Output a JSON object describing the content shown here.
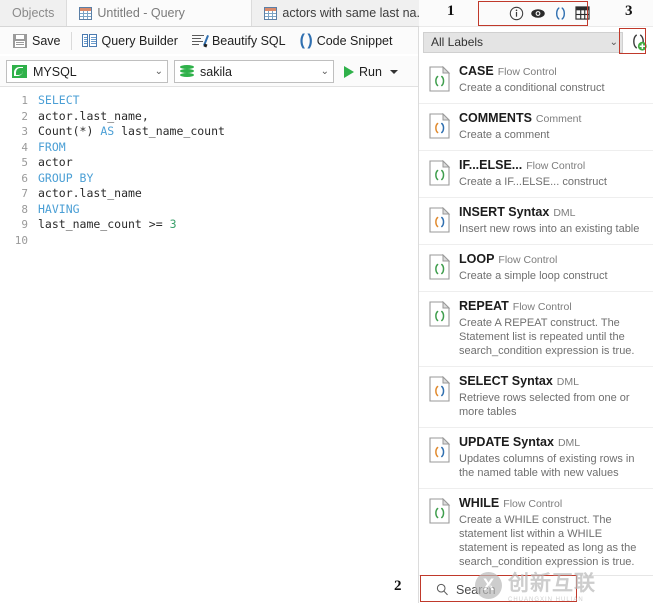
{
  "tabs": [
    {
      "label": "Objects",
      "icon": null,
      "active": false
    },
    {
      "label": "Untitled - Query",
      "icon": "grid-icon",
      "active": true
    },
    {
      "label": "actors with same last na...",
      "icon": "grid-icon",
      "active": false
    }
  ],
  "toolbar": {
    "save_label": "Save",
    "query_builder_label": "Query Builder",
    "beautify_label": "Beautify SQL",
    "code_snippet_label": "Code Snippet",
    "overflow_label": "»",
    "connection_value": "MYSQL",
    "database_value": "sakila",
    "run_label": "Run"
  },
  "editor": {
    "lines": [
      {
        "n": "1",
        "segments": [
          {
            "t": "SELECT",
            "k": "kw"
          }
        ]
      },
      {
        "n": "2",
        "segments": [
          {
            "t": "actor.last_name,",
            "k": ""
          }
        ]
      },
      {
        "n": "3",
        "segments": [
          {
            "t": "Count(*) ",
            "k": ""
          },
          {
            "t": "AS",
            "k": "kw"
          },
          {
            "t": " last_name_count",
            "k": ""
          }
        ]
      },
      {
        "n": "4",
        "segments": [
          {
            "t": "FROM",
            "k": "kw"
          }
        ]
      },
      {
        "n": "5",
        "segments": [
          {
            "t": "actor",
            "k": ""
          }
        ]
      },
      {
        "n": "6",
        "segments": [
          {
            "t": "GROUP BY",
            "k": "kw"
          }
        ]
      },
      {
        "n": "7",
        "segments": [
          {
            "t": "actor.last_name",
            "k": ""
          }
        ]
      },
      {
        "n": "8",
        "segments": [
          {
            "t": "HAVING",
            "k": "kw"
          }
        ]
      },
      {
        "n": "9",
        "segments": [
          {
            "t": "last_name_count >= ",
            "k": ""
          },
          {
            "t": "3",
            "k": "num-lit"
          }
        ]
      },
      {
        "n": "10",
        "segments": [
          {
            "t": "",
            "k": ""
          }
        ]
      }
    ]
  },
  "panel": {
    "header_icons": [
      "info-icon",
      "eye-icon",
      "parentheses-icon",
      "table-icon"
    ],
    "label_filter_value": "All Labels",
    "add_snippet_icon": "add-snippet-icon",
    "search_placeholder": "Search",
    "search_icon": "search-icon",
    "snippets": [
      {
        "name": "CASE",
        "category": "Flow Control",
        "desc": "Create a conditional construct",
        "color": "green"
      },
      {
        "name": "COMMENTS",
        "category": "Comment",
        "desc": "Create a comment",
        "color": "orange"
      },
      {
        "name": "IF...ELSE...",
        "category": "Flow Control",
        "desc": "Create a IF...ELSE... construct",
        "color": "green"
      },
      {
        "name": "INSERT Syntax",
        "category": "DML",
        "desc": "Insert new rows into an existing table",
        "color": "orange"
      },
      {
        "name": "LOOP",
        "category": "Flow Control",
        "desc": "Create a simple loop construct",
        "color": "green"
      },
      {
        "name": "REPEAT",
        "category": "Flow Control",
        "desc": "Create A REPEAT construct. The Statement list is repeated until the search_condition expression is true.",
        "color": "green"
      },
      {
        "name": "SELECT Syntax",
        "category": "DML",
        "desc": "Retrieve rows selected from one or more tables",
        "color": "orange"
      },
      {
        "name": "UPDATE Syntax",
        "category": "DML",
        "desc": "Updates columns of existing rows in the named table with new values",
        "color": "orange"
      },
      {
        "name": "WHILE",
        "category": "Flow Control",
        "desc": "Create a WHILE construct. The statement list within a WHILE statement is repeated as long as the search_condition expression is true.",
        "color": "green"
      }
    ]
  },
  "annotations": [
    {
      "number": "1"
    },
    {
      "number": "2"
    },
    {
      "number": "3"
    }
  ],
  "watermark": {
    "mark": "X",
    "text": "创新互联",
    "sub": "CHUANGXIN HULIAN"
  },
  "colors": {
    "keyword": "#4b9fd5",
    "number_literal": "#3aa06a",
    "accent_green": "#2fb14a",
    "annotation_red": "#c0392b"
  }
}
